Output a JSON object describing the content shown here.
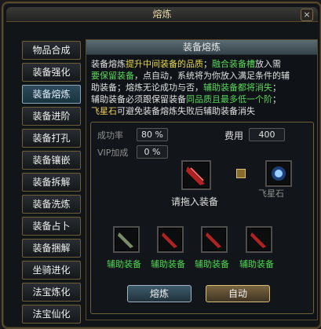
{
  "window": {
    "title": "熔炼",
    "close_label": "×"
  },
  "sidebar": {
    "items": [
      {
        "label": "物品合成",
        "active": false
      },
      {
        "label": "装备强化",
        "active": false
      },
      {
        "label": "装备熔炼",
        "active": true
      },
      {
        "label": "装备进阶",
        "active": false
      },
      {
        "label": "装备打孔",
        "active": false
      },
      {
        "label": "装备镶嵌",
        "active": false
      },
      {
        "label": "装备拆解",
        "active": false
      },
      {
        "label": "装备洗炼",
        "active": false
      },
      {
        "label": "装备占卜",
        "active": false
      },
      {
        "label": "装备捆解",
        "active": false
      },
      {
        "label": "坐骑进化",
        "active": false
      },
      {
        "label": "法宝炼化",
        "active": false
      },
      {
        "label": "法宝仙化",
        "active": false
      }
    ]
  },
  "content": {
    "header": "装备熔炼",
    "desc": [
      [
        {
          "t": "装备熔炼",
          "c": "w"
        },
        {
          "t": "提升中间装备的品质",
          "c": "y"
        },
        {
          "t": "；",
          "c": "w"
        },
        {
          "t": "融合装备槽",
          "c": "g"
        },
        {
          "t": "放入需",
          "c": "w"
        }
      ],
      [
        {
          "t": "要保留装备",
          "c": "g"
        },
        {
          "t": "，点自动，系统将为你放入满足条件的辅",
          "c": "w"
        }
      ],
      [
        {
          "t": "助装备；熔炼无论成功与否，",
          "c": "w"
        },
        {
          "t": "辅助装备都将消失",
          "c": "g"
        },
        {
          "t": "；",
          "c": "w"
        }
      ],
      [
        {
          "t": "辅助装备必须跟保留装备",
          "c": "w"
        },
        {
          "t": "同品质且最多低一个阶",
          "c": "g"
        },
        {
          "t": "；",
          "c": "w"
        }
      ],
      [
        {
          "t": "飞星石",
          "c": "o"
        },
        {
          "t": "可避免装备熔炼失败后辅助装备消失",
          "c": "w"
        }
      ]
    ],
    "success_label": "成功率",
    "success_value": "80 %",
    "vip_label": "VIP加成",
    "vip_value": "0 %",
    "cost_label": "费用",
    "cost_value": "400",
    "drop_hint": "请拖入装备",
    "stone_label": "飞星石",
    "aux_label": "辅助装备",
    "btn_smelt": "熔炼",
    "btn_auto": "自动"
  },
  "colors": {
    "accent_gold": "#e6d94b",
    "green_text": "#4cd84e",
    "orange_text": "#f0d060"
  }
}
